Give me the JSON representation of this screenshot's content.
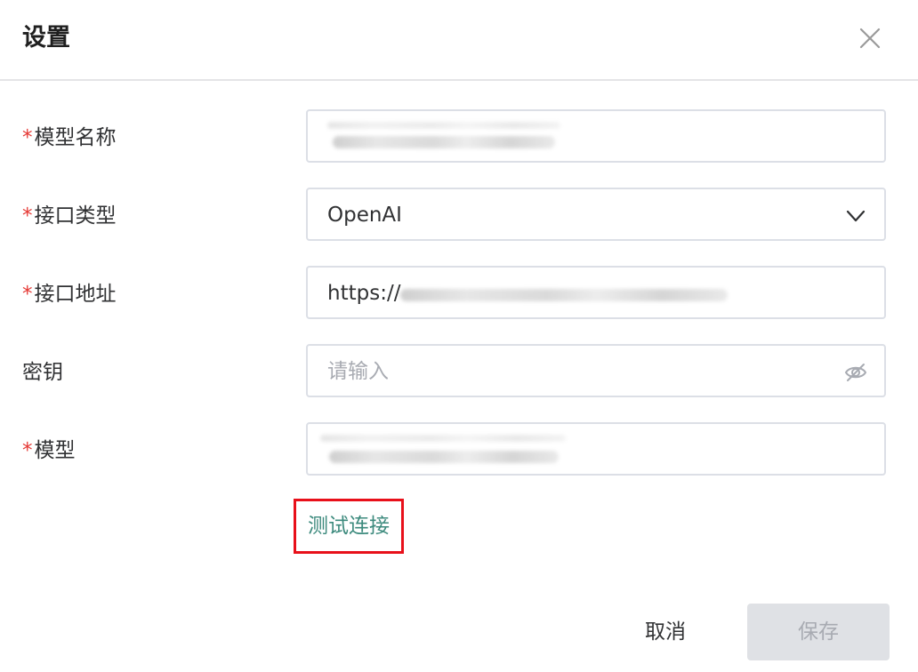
{
  "dialog": {
    "title": "设置",
    "close_icon": "close-icon"
  },
  "form": {
    "required_mark": "*",
    "model_name": {
      "label": "模型名称",
      "required": true,
      "value": ""
    },
    "api_type": {
      "label": "接口类型",
      "required": true,
      "value": "OpenAI",
      "icon": "chevron-down-icon"
    },
    "api_url": {
      "label": "接口地址",
      "required": true,
      "value": "https://"
    },
    "api_key": {
      "label": "密钥",
      "required": false,
      "placeholder": "请输入",
      "icon": "eye-off-icon"
    },
    "model": {
      "label": "模型",
      "required": true,
      "value": ""
    }
  },
  "test_connection": {
    "label": "测试连接",
    "link_color": "#3c8a7d",
    "highlight_color": "#e8101a"
  },
  "footer": {
    "cancel_label": "取消",
    "save_label": "保存",
    "save_disabled": true
  }
}
